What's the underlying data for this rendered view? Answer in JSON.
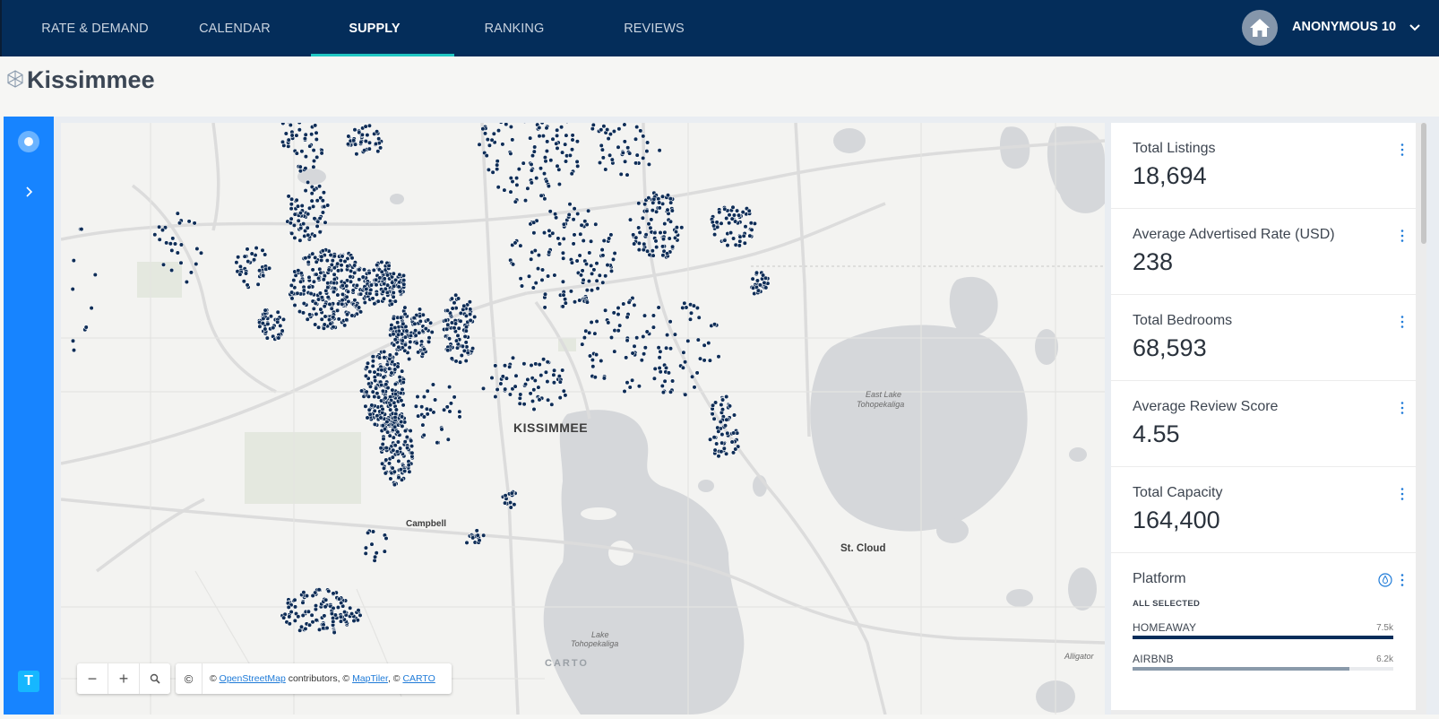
{
  "nav": {
    "tabs": [
      {
        "label": "RATE & DEMAND",
        "active": false
      },
      {
        "label": "CALENDAR",
        "active": false
      },
      {
        "label": "SUPPLY",
        "active": true
      },
      {
        "label": "RANKING",
        "active": false
      },
      {
        "label": "REVIEWS",
        "active": false
      }
    ],
    "user": {
      "name": "ANONYMOUS 10",
      "avatar_icon": "home-icon"
    },
    "colors": {
      "background": "#042d5a",
      "active_underline": "#21c7c3"
    }
  },
  "page": {
    "title": "Kissimmee",
    "title_icon": "cube-icon"
  },
  "rail": {
    "bottom_badge": "T",
    "color": "#1784ff"
  },
  "map": {
    "labels": {
      "city": "KISSIMMEE",
      "campbell": "Campbell",
      "st_cloud": "St. Cloud",
      "east_lake_1": "East Lake",
      "east_lake_2": "Tohopekaliga",
      "lake_toho_1": "Lake",
      "lake_toho_2": "Tohopekaliga",
      "alligator": "Alligator",
      "carto_logo": "CARTO"
    },
    "controls": {
      "zoom_out": "−",
      "zoom_in": "+",
      "search_icon": "search-icon"
    },
    "attribution": {
      "copyright": "©",
      "prefix": "© ",
      "osm": "OpenStreetMap",
      "mid": " contributors, © ",
      "maptiler": "MapTiler",
      "sep": ", © ",
      "carto": "CARTO"
    },
    "marker_color": "#0e2d57"
  },
  "stats": [
    {
      "label": "Total Listings",
      "value": "18,694"
    },
    {
      "label": "Average Advertised Rate (USD)",
      "value": "238"
    },
    {
      "label": "Total Bedrooms",
      "value": "68,593"
    },
    {
      "label": "Average Review Score",
      "value": "4.55"
    },
    {
      "label": "Total Capacity",
      "value": "164,400"
    }
  ],
  "platform": {
    "title": "Platform",
    "selection": "ALL SELECTED",
    "rows": [
      {
        "name": "HOMEAWAY",
        "value": "7.5k",
        "fraction": 1.0,
        "color": "#042d5a"
      },
      {
        "name": "AIRBNB",
        "value": "6.2k",
        "fraction": 0.83,
        "color": "#8a9aaa"
      }
    ]
  }
}
